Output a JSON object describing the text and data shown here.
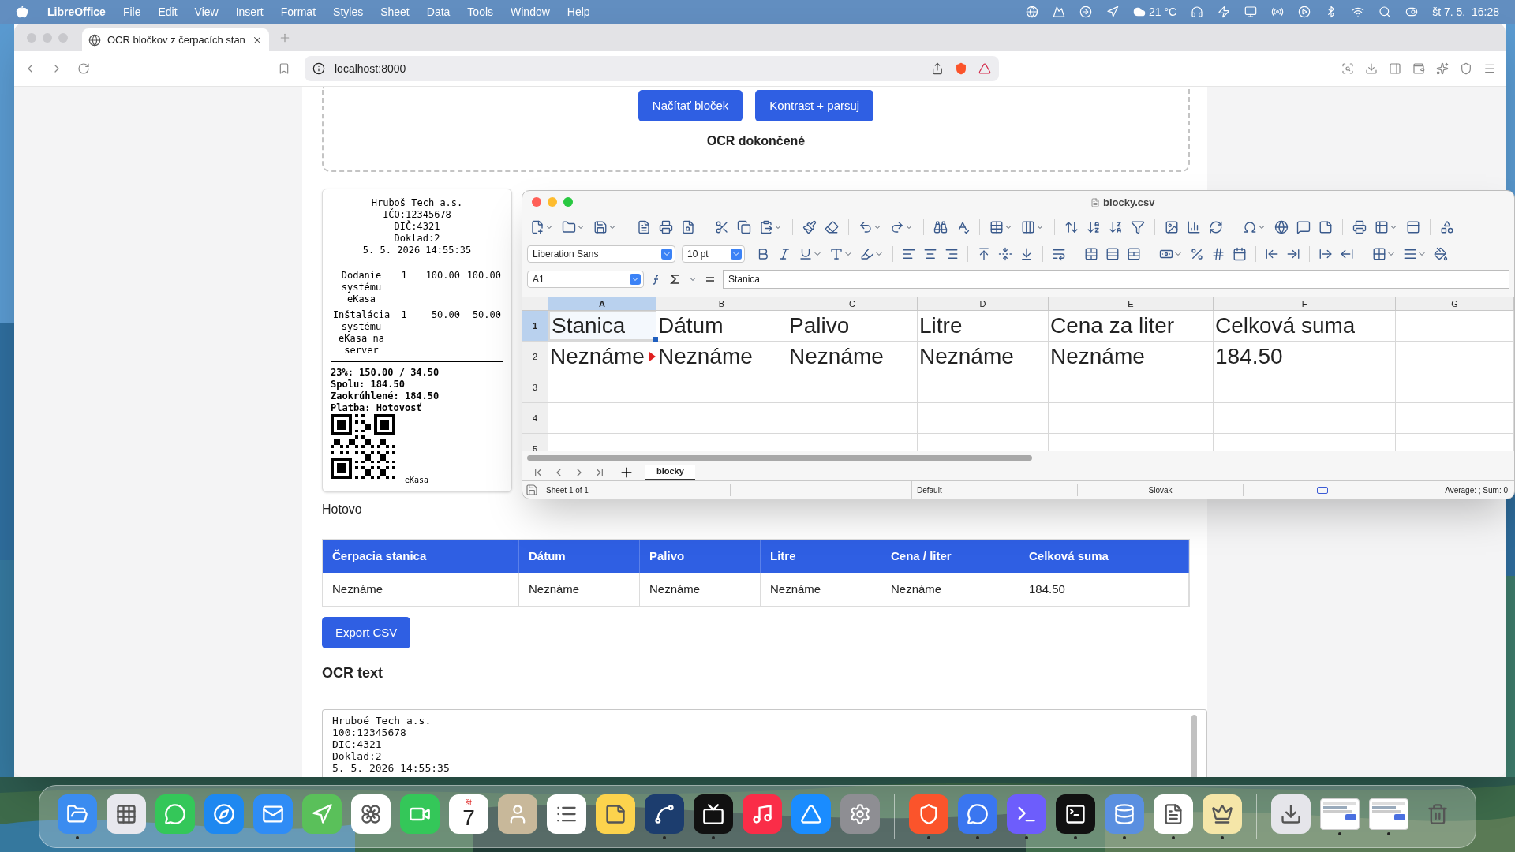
{
  "menu_bar": {
    "app": "LibreOffice",
    "menus": [
      "File",
      "Edit",
      "View",
      "Insert",
      "Format",
      "Styles",
      "Sheet",
      "Data",
      "Tools",
      "Window",
      "Help"
    ],
    "weather": "21 °C",
    "clock": "št 7. 5.  16:28"
  },
  "browser": {
    "tab_title": "OCR bločkov z čerpacích stan",
    "address": "localhost:8000"
  },
  "page": {
    "buttons": [
      "Načítať bloček",
      "Kontrast + parsuj"
    ],
    "ocr_status": "OCR dokončené",
    "receipt": {
      "header": [
        "Hruboš Tech a.s.",
        "IČO:12345678",
        "DIČ:4321",
        "Doklad:2",
        "5. 5. 2026 14:55:35"
      ],
      "items": [
        {
          "name": [
            "Dodanie",
            "systému",
            "eKasa"
          ],
          "qty": "1",
          "price": "100.00",
          "total": "100.00"
        },
        {
          "name": [
            "Inštalácia",
            "systému",
            "eKasa na",
            "server"
          ],
          "qty": "1",
          "price": "50.00",
          "total": "50.00"
        }
      ],
      "summary": [
        "23%: 150.00 / 34.50",
        "Spolu: 184.50",
        "Zaokrúhlené: 184.50",
        "Platba: Hotovosť"
      ],
      "footer": "eKasa"
    },
    "status": "Hotovo",
    "table": {
      "columns": [
        "Čerpacia stanica",
        "Dátum",
        "Palivo",
        "Litre",
        "Cena / liter",
        "Celková suma"
      ],
      "rows": [
        [
          "Neznáme",
          "Neznáme",
          "Neznáme",
          "Neznáme",
          "Neznáme",
          "184.50"
        ]
      ]
    },
    "export_button": "Export CSV",
    "ocr_heading": "OCR text",
    "ocr_text": [
      "Hruboé Tech a.s.",
      "100:12345678",
      "DIC:4321",
      "Doklad:2",
      "5. 5. 2026 14:55:35"
    ]
  },
  "calc": {
    "title": "blocky.csv",
    "font_name": "Liberation Sans",
    "font_size": "10 pt",
    "cell_ref": "A1",
    "formula": "Stanica",
    "columns": [
      {
        "label": "A",
        "selected": true
      },
      {
        "label": "B",
        "selected": false
      },
      {
        "label": "C",
        "selected": false
      },
      {
        "label": "D",
        "selected": false
      },
      {
        "label": "E",
        "selected": false
      },
      {
        "label": "F",
        "selected": false
      },
      {
        "label": "G",
        "selected": false
      }
    ],
    "rows": [
      {
        "label": "1",
        "selected": true,
        "cells": [
          {
            "text": "Stanica",
            "selected": true,
            "overflow": false
          },
          {
            "text": "Dátum",
            "selected": false,
            "overflow": false
          },
          {
            "text": "Palivo",
            "selected": false,
            "overflow": false
          },
          {
            "text": "Litre",
            "selected": false,
            "overflow": false
          },
          {
            "text": "Cena za liter",
            "selected": false,
            "overflow": false
          },
          {
            "text": "Celková suma",
            "selected": false,
            "overflow": false
          }
        ]
      },
      {
        "label": "2",
        "selected": false,
        "cells": [
          {
            "text": "Neznáme",
            "selected": false,
            "overflow": true
          },
          {
            "text": "Neznáme",
            "selected": false,
            "overflow": false
          },
          {
            "text": "Neznáme",
            "selected": false,
            "overflow": false
          },
          {
            "text": "Neznáme",
            "selected": false,
            "overflow": false
          },
          {
            "text": "Neznáme",
            "selected": false,
            "overflow": false
          },
          {
            "text": "184.50",
            "selected": false,
            "overflow": false
          }
        ]
      },
      {
        "label": "3",
        "selected": false
      },
      {
        "label": "4",
        "selected": false
      },
      {
        "label": "5",
        "selected": false
      }
    ],
    "sheet_tab": {
      "label": "blocky",
      "selected": true
    },
    "status": {
      "sheet": "Sheet 1 of 1",
      "style": "Default",
      "language": "Slovak",
      "summary": "Average: ; Sum: 0"
    }
  },
  "dock": [
    [
      {
        "kind": "app",
        "running": true
      },
      {
        "kind": "app",
        "running": false
      },
      {
        "kind": "app",
        "running": false
      },
      {
        "kind": "app",
        "running": false
      },
      {
        "kind": "app",
        "running": false
      },
      {
        "kind": "app",
        "running": false
      },
      {
        "kind": "app",
        "running": false
      },
      {
        "kind": "app",
        "running": false
      },
      {
        "kind": "calendar",
        "weekday": "št",
        "day": "7",
        "running": false
      },
      {
        "kind": "app",
        "running": false
      },
      {
        "kind": "app",
        "running": false
      },
      {
        "kind": "app",
        "running": false
      },
      {
        "kind": "app",
        "running": true
      },
      {
        "kind": "app",
        "running": true
      },
      {
        "kind": "app",
        "running": false
      },
      {
        "kind": "app",
        "running": false
      },
      {
        "kind": "app",
        "running": false
      }
    ],
    [
      {
        "kind": "app",
        "running": true
      },
      {
        "kind": "app",
        "running": true
      },
      {
        "kind": "app",
        "running": true
      },
      {
        "kind": "app",
        "running": true
      },
      {
        "kind": "app",
        "running": true
      },
      {
        "kind": "app",
        "running": true
      },
      {
        "kind": "app",
        "running": true
      }
    ],
    [
      {
        "kind": "app",
        "running": false
      },
      {
        "kind": "thumbnail",
        "running": true
      },
      {
        "kind": "thumbnail",
        "running": true
      },
      {
        "kind": "app",
        "running": false
      }
    ]
  ]
}
